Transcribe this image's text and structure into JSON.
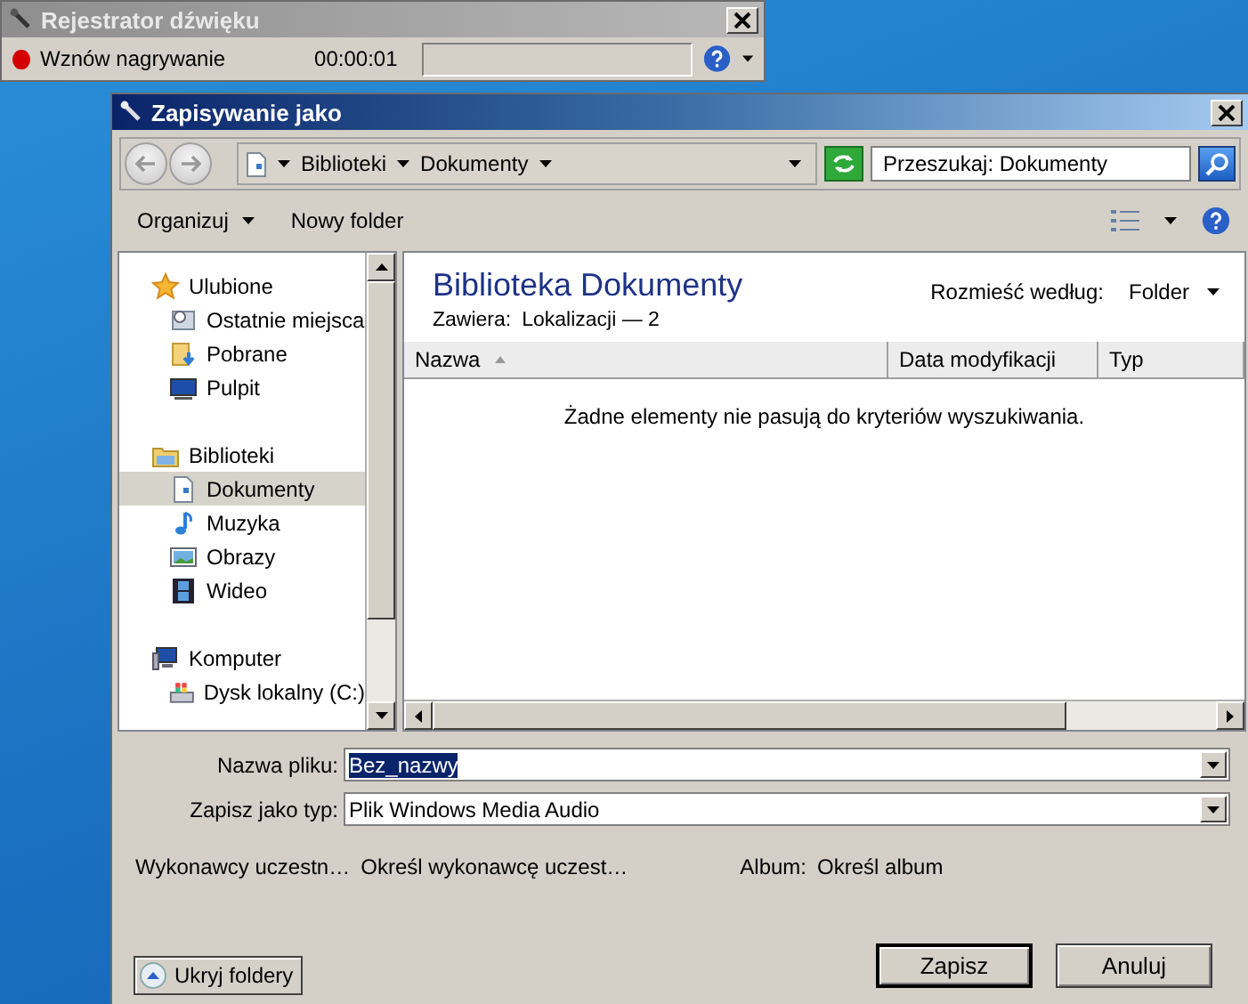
{
  "recorder": {
    "title": "Rejestrator dźwięku",
    "action": "Wznów nagrywanie",
    "time": "00:00:01"
  },
  "dialog": {
    "title": "Zapisywanie jako",
    "breadcrumb": [
      "Biblioteki",
      "Dokumenty"
    ],
    "search": {
      "placeholder": "Przeszukaj: Dokumenty"
    },
    "toolbar": {
      "organize": "Organizuj",
      "new_folder": "Nowy folder"
    },
    "nav": [
      {
        "label": "Ulubione",
        "kind": "star",
        "selected": false,
        "children": [
          {
            "label": "Ostatnie miejsca",
            "kind": "recent",
            "selected": false
          },
          {
            "label": "Pobrane",
            "kind": "download",
            "selected": false
          },
          {
            "label": "Pulpit",
            "kind": "desktop",
            "selected": false
          }
        ]
      },
      {
        "label": "Biblioteki",
        "kind": "library",
        "selected": false,
        "children": [
          {
            "label": "Dokumenty",
            "kind": "document",
            "selected": true
          },
          {
            "label": "Muzyka",
            "kind": "music",
            "selected": false
          },
          {
            "label": "Obrazy",
            "kind": "picture",
            "selected": false
          },
          {
            "label": "Wideo",
            "kind": "video",
            "selected": false
          }
        ]
      },
      {
        "label": "Komputer",
        "kind": "computer",
        "selected": false,
        "children": [
          {
            "label": "Dysk lokalny (C:)",
            "kind": "drive",
            "selected": false
          }
        ]
      }
    ],
    "library": {
      "title": "Biblioteka Dokumenty",
      "contains_label": "Zawiera:",
      "contains_value": "Lokalizacji — 2",
      "arrange_label": "Rozmieść według:",
      "arrange_value": "Folder"
    },
    "columns": [
      "Nazwa",
      "Data modyfikacji",
      "Typ"
    ],
    "empty_message": "Żadne elementy nie pasują do kryteriów wyszukiwania.",
    "fields": [
      {
        "label": "Nazwa pliku:",
        "value": "Bez_nazwy",
        "selected": true
      },
      {
        "label": "Zapisz jako typ:",
        "value": "Plik Windows Media Audio",
        "selected": false
      }
    ],
    "metadata": [
      {
        "label": "Wykonawcy uczestn…",
        "value": "Określ wykonawcę uczest…"
      },
      {
        "label": "Album:",
        "value": "Określ album"
      }
    ],
    "hide_folders": "Ukryj foldery",
    "buttons": [
      "Zapisz",
      "Anuluj"
    ]
  }
}
